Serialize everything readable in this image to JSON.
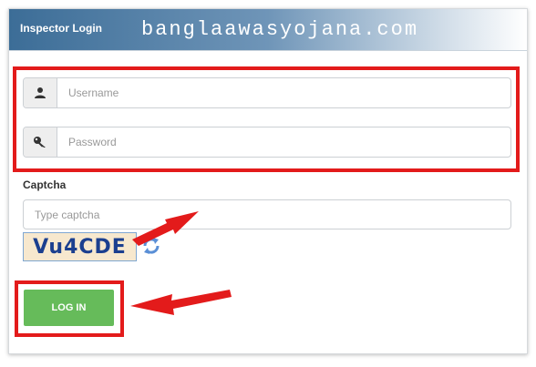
{
  "header": {
    "title": "Inspector Login",
    "watermark": "banglaawasyojana.com"
  },
  "form": {
    "username": {
      "placeholder": "Username",
      "value": ""
    },
    "password": {
      "placeholder": "Password",
      "value": ""
    },
    "captcha_label": "Captcha",
    "captcha_input": {
      "placeholder": "Type captcha",
      "value": ""
    },
    "captcha_code": "Vu4CDE",
    "login_label": "LOG IN"
  },
  "icons": {
    "username": "user-icon",
    "password": "key-icon",
    "refresh": "refresh-icon"
  },
  "colors": {
    "header_blue": "#3c6d97",
    "highlight_red": "#e31b1b",
    "login_green": "#66bb5a",
    "captcha_bg": "#f7e8ce",
    "captcha_text": "#1b3f8f"
  }
}
